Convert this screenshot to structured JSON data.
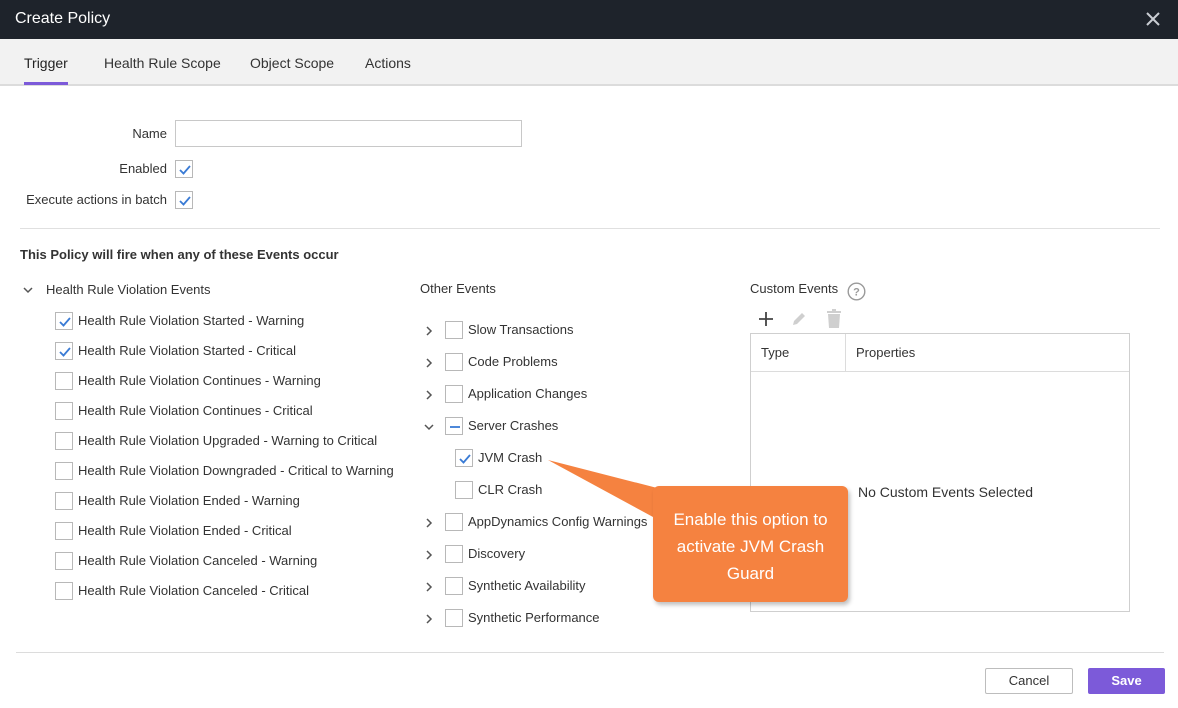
{
  "dialog": {
    "title": "Create Policy",
    "close_icon": "close-icon"
  },
  "tabs": [
    {
      "label": "Trigger",
      "active": true
    },
    {
      "label": "Health Rule Scope",
      "active": false
    },
    {
      "label": "Object Scope",
      "active": false
    },
    {
      "label": "Actions",
      "active": false
    }
  ],
  "form": {
    "name_label": "Name",
    "name_value": "",
    "enabled_label": "Enabled",
    "enabled_checked": true,
    "batch_label": "Execute actions in batch",
    "batch_checked": true
  },
  "events_section_title": "This Policy will fire when any of these Events occur",
  "health_rule": {
    "title": "Health Rule Violation Events",
    "expanded": true,
    "items": [
      {
        "label": "Health Rule Violation Started - Warning",
        "checked": true
      },
      {
        "label": "Health Rule Violation Started - Critical",
        "checked": true
      },
      {
        "label": "Health Rule Violation Continues - Warning",
        "checked": false
      },
      {
        "label": "Health Rule Violation Continues - Critical",
        "checked": false
      },
      {
        "label": "Health Rule Violation Upgraded - Warning to Critical",
        "checked": false
      },
      {
        "label": "Health Rule Violation Downgraded - Critical to Warning",
        "checked": false
      },
      {
        "label": "Health Rule Violation Ended - Warning",
        "checked": false
      },
      {
        "label": "Health Rule Violation Ended - Critical",
        "checked": false
      },
      {
        "label": "Health Rule Violation Canceled - Warning",
        "checked": false
      },
      {
        "label": "Health Rule Violation Canceled - Critical",
        "checked": false
      }
    ]
  },
  "other_events": {
    "title": "Other Events",
    "groups": [
      {
        "label": "Slow Transactions",
        "state": "unchecked",
        "expanded": false
      },
      {
        "label": "Code Problems",
        "state": "unchecked",
        "expanded": false
      },
      {
        "label": "Application Changes",
        "state": "unchecked",
        "expanded": false
      },
      {
        "label": "Server Crashes",
        "state": "partial",
        "expanded": true
      },
      {
        "label": "AppDynamics Config Warnings",
        "state": "unchecked",
        "expanded": false
      },
      {
        "label": "Discovery",
        "state": "unchecked",
        "expanded": false
      },
      {
        "label": "Synthetic Availability",
        "state": "unchecked",
        "expanded": false
      },
      {
        "label": "Synthetic Performance",
        "state": "unchecked",
        "expanded": false
      }
    ],
    "server_crash_children": [
      {
        "label": "JVM Crash",
        "checked": true
      },
      {
        "label": "CLR Crash",
        "checked": false
      }
    ]
  },
  "custom_events": {
    "title": "Custom Events",
    "help_icon": "question-circle-icon",
    "toolbar": [
      "add-icon",
      "edit-icon",
      "delete-icon"
    ],
    "columns": [
      "Type",
      "Properties"
    ],
    "empty_text": "No Custom Events Selected"
  },
  "callout": {
    "text": "Enable this option to activate JVM Crash Guard",
    "color": "#f58240"
  },
  "footer": {
    "cancel_label": "Cancel",
    "save_label": "Save"
  },
  "colors": {
    "accent": "#7c5ad9",
    "titlebar": "#1e232b",
    "check": "#3a7bd5"
  }
}
